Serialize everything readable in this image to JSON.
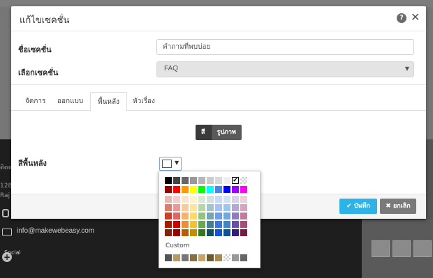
{
  "modal": {
    "title": "แก้ไขเซคชั่น",
    "section_name_label": "ชื่อเซคชั่น",
    "section_name_value": "คำถามที่พบบ่อย",
    "choose_section_label": "เลือกเซคชั่น",
    "choose_section_value": "FAQ",
    "tabs": [
      {
        "label": "จัดการ",
        "active": false
      },
      {
        "label": "ออกแบบ",
        "active": false
      },
      {
        "label": "พื้นหลัง",
        "active": true
      },
      {
        "label": "หัวเรื่อง",
        "active": false
      }
    ],
    "bg_type_toggle": {
      "color_label": "สี",
      "image_label": "รูปภาพ",
      "selected": "สี"
    },
    "bg_color_label": "สีพื้นหลัง",
    "bg_color_value": "#ffffff",
    "save_label": "บันทึก",
    "cancel_label": "ยกเลิก"
  },
  "palette": {
    "custom_label": "Custom",
    "selected": "#ffffff",
    "rows": [
      [
        "#000000",
        "#434343",
        "#666666",
        "#999999",
        "#b7b7b7",
        "#cccccc",
        "#d9d9d9",
        "#efefef",
        "#ffffff",
        "transparent"
      ],
      [
        "#980000",
        "#ff0000",
        "#ff9900",
        "#ffff00",
        "#00ff00",
        "#00ffff",
        "#4a86e8",
        "#0000ff",
        "#9900ff",
        "#ff00ff"
      ],
      [
        "#e6b8af",
        "#f4cccc",
        "#fce5cd",
        "#fff2cc",
        "#d9ead3",
        "#d0e0e3",
        "#c9daf8",
        "#cfe2f3",
        "#d9d2e9",
        "#ead1dc"
      ],
      [
        "#dd7e6b",
        "#ea9999",
        "#f9cb9c",
        "#ffe599",
        "#b6d7a8",
        "#a2c4c9",
        "#a4c2f4",
        "#9fc5e8",
        "#b4a7d6",
        "#d5a6bd"
      ],
      [
        "#cc4125",
        "#e06666",
        "#f6b26b",
        "#ffd966",
        "#93c47d",
        "#76a5af",
        "#6d9eeb",
        "#6fa8dc",
        "#8e7cc3",
        "#c27ba0"
      ],
      [
        "#a61c00",
        "#cc0000",
        "#e69138",
        "#f1c232",
        "#6aa84f",
        "#45818e",
        "#3c78d8",
        "#3d85c6",
        "#674ea7",
        "#a64d79"
      ],
      [
        "#85200c",
        "#990000",
        "#b45f06",
        "#bf9000",
        "#38761d",
        "#134f5c",
        "#1155cc",
        "#0b5394",
        "#351c75",
        "#741b47"
      ]
    ],
    "custom_colors": [
      "#555555",
      "#b59a66",
      "#777777",
      "#8c6d3f",
      "#c9a46a",
      "#6b5a2e",
      "#a68a52",
      "transparent",
      "#999999",
      "#666666"
    ]
  },
  "background_page": {
    "email": "info@makewebeasy.com",
    "social_label": "Social",
    "address_fragment_1": "ติดต่อ",
    "address_fragment_2": "128",
    "address_fragment_3": "Raj"
  },
  "colors": {
    "save_button": "#2fb3e6",
    "cancel_button": "#7a7a7a",
    "toggle_active": "#3a3a3a"
  }
}
